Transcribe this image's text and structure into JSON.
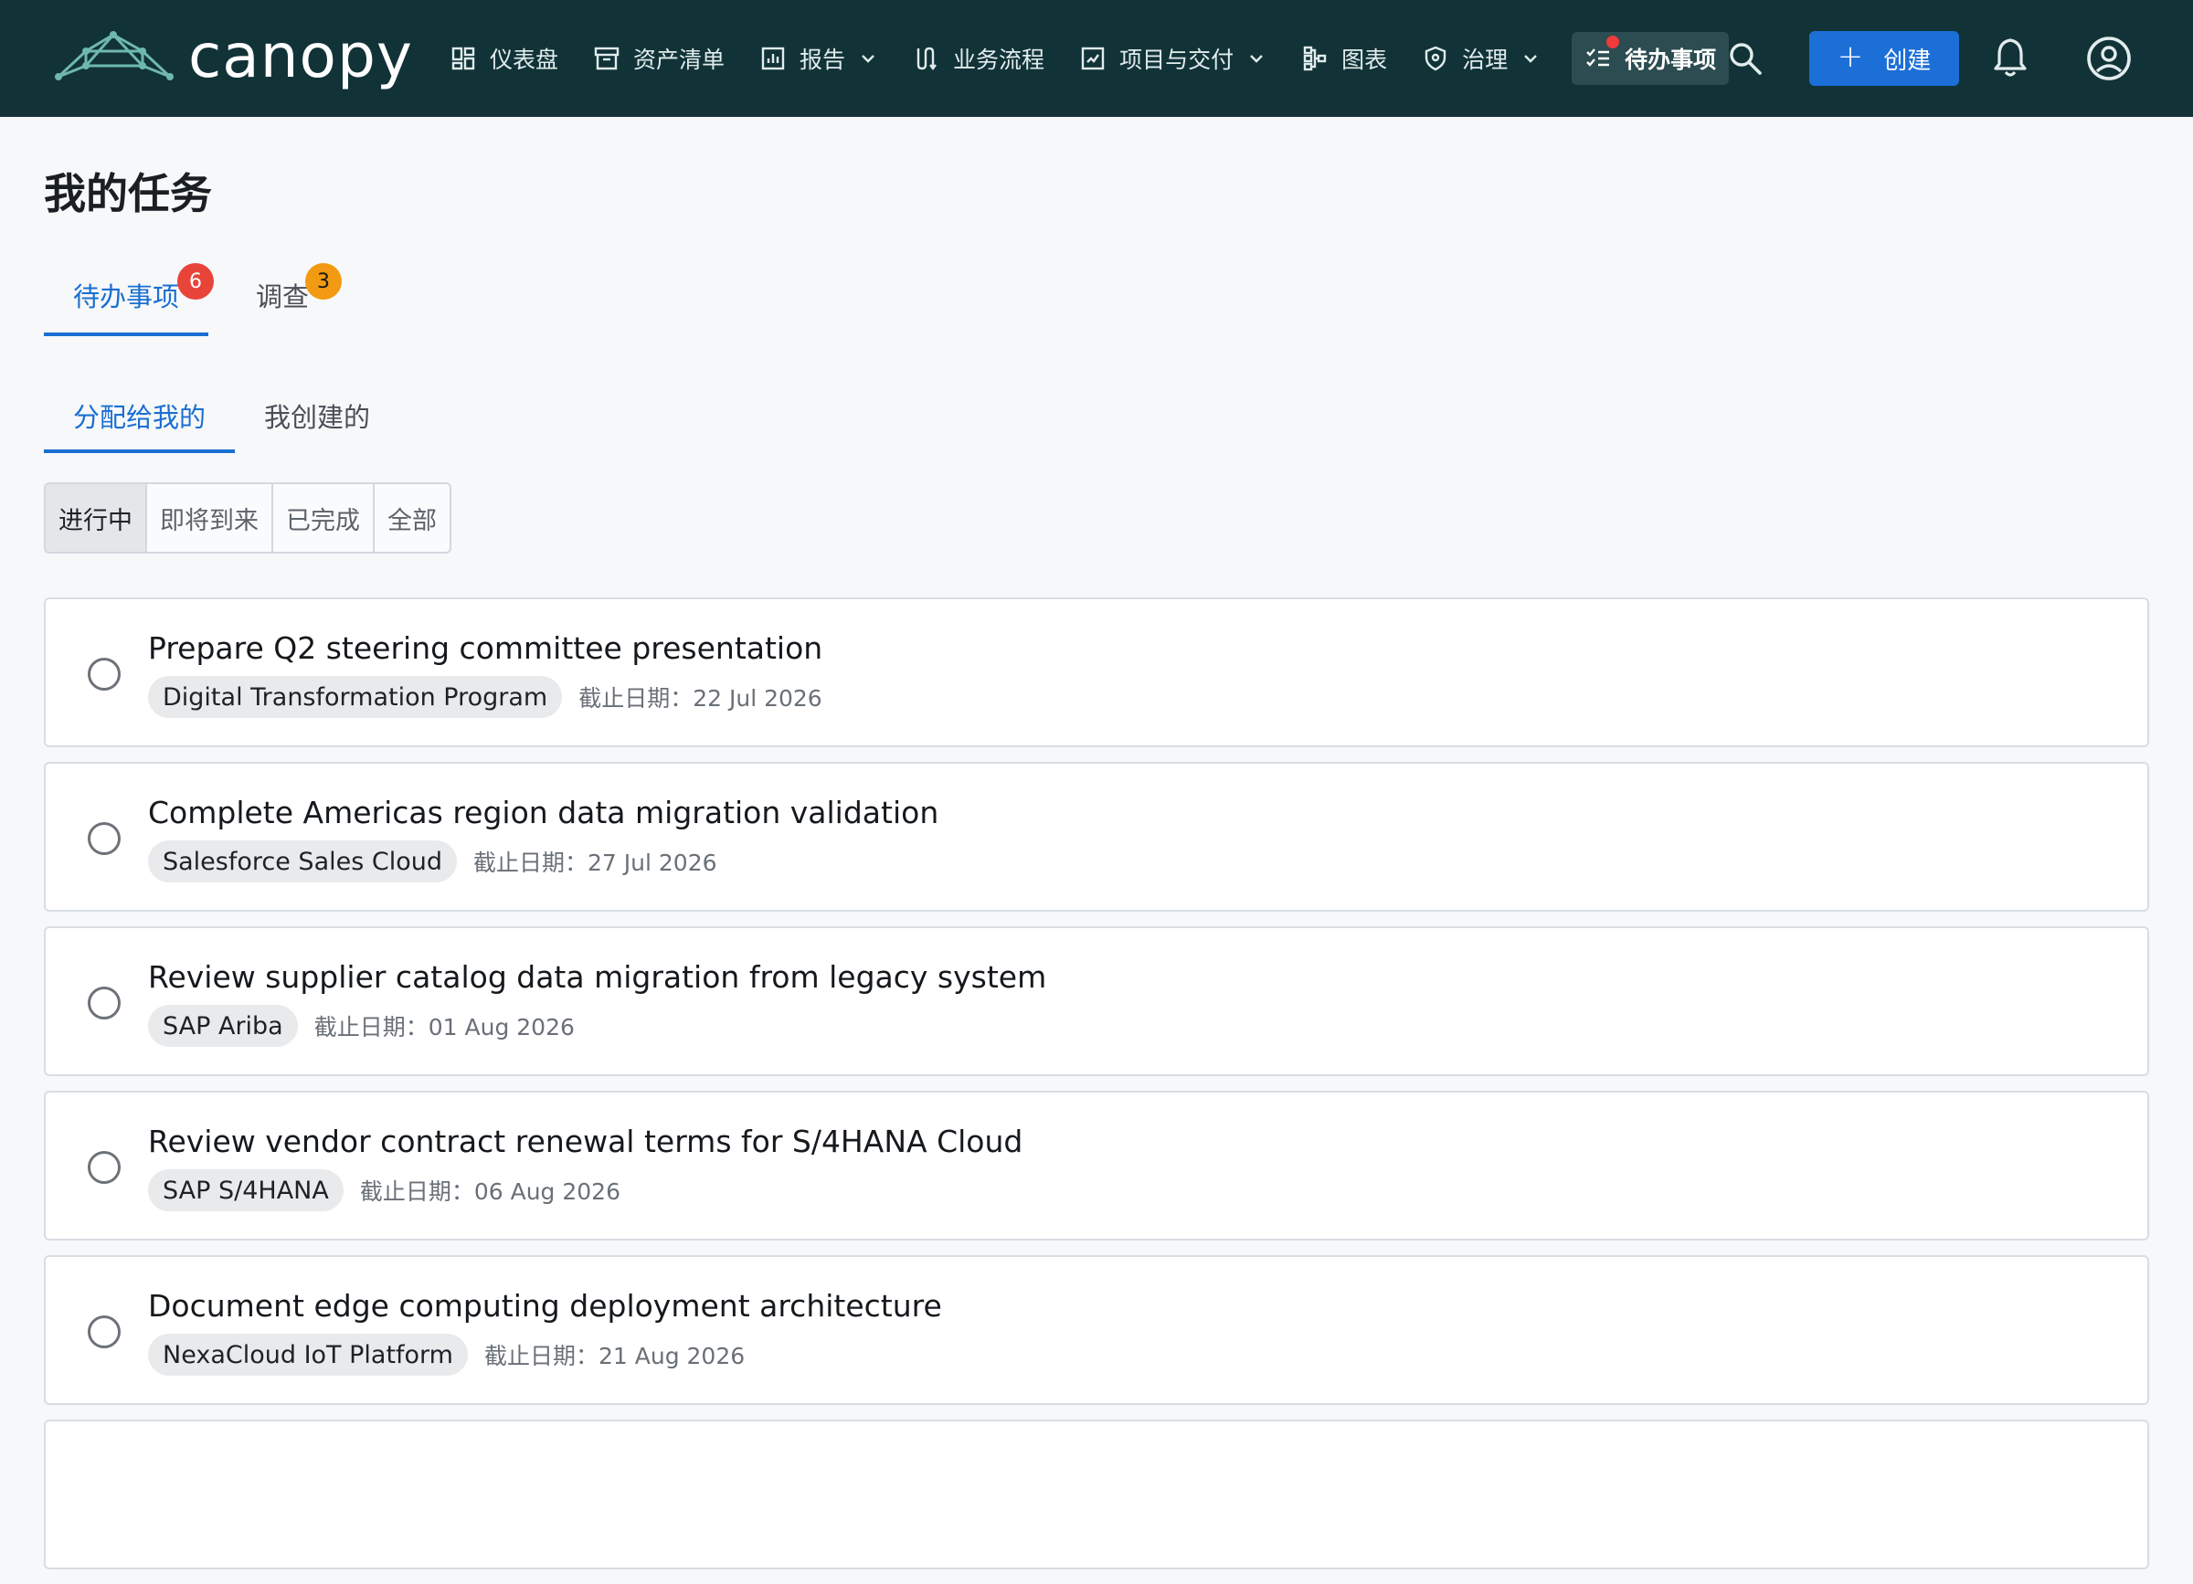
{
  "app": {
    "brand": "canopy"
  },
  "nav": {
    "items": [
      {
        "label": "仪表盘",
        "icon": "dashboard-icon",
        "has_dropdown": false
      },
      {
        "label": "资产清单",
        "icon": "archive-icon",
        "has_dropdown": false
      },
      {
        "label": "报告",
        "icon": "report-icon",
        "has_dropdown": true
      },
      {
        "label": "业务流程",
        "icon": "process-icon",
        "has_dropdown": false
      },
      {
        "label": "项目与交付",
        "icon": "project-icon",
        "has_dropdown": true
      },
      {
        "label": "图表",
        "icon": "diagram-icon",
        "has_dropdown": false
      },
      {
        "label": "治理",
        "icon": "shield-icon",
        "has_dropdown": true
      }
    ],
    "active_item": {
      "label": "待办事项",
      "icon": "checklist-icon",
      "has_notification_dot": true
    },
    "create_label": "创建",
    "search_icon": "search-icon",
    "bell_icon": "bell-icon",
    "avatar_icon": "user-avatar-icon"
  },
  "page": {
    "title": "我的任务",
    "primary_tabs": [
      {
        "label": "待办事项",
        "badge": "6",
        "active": true
      },
      {
        "label": "调查",
        "badge": "3",
        "active": false
      }
    ],
    "secondary_tabs": [
      {
        "label": "分配给我的",
        "active": true
      },
      {
        "label": "我创建的",
        "active": false
      }
    ],
    "filters": [
      {
        "label": "进行中",
        "active": true
      },
      {
        "label": "即将到来",
        "active": false
      },
      {
        "label": "已完成",
        "active": false
      },
      {
        "label": "全部",
        "active": false
      }
    ]
  },
  "tasks": [
    {
      "title": "Prepare Q2 steering committee presentation",
      "tag": "Digital Transformation Program",
      "due": "截止日期：22 Jul 2026"
    },
    {
      "title": "Complete Americas region data migration validation",
      "tag": "Salesforce Sales Cloud",
      "due": "截止日期：27 Jul 2026"
    },
    {
      "title": "Review supplier catalog data migration from legacy system",
      "tag": "SAP Ariba",
      "due": "截止日期：01 Aug 2026"
    },
    {
      "title": "Review vendor contract renewal terms for S/4HANA Cloud",
      "tag": "SAP S/4HANA",
      "due": "截止日期：06 Aug 2026"
    },
    {
      "title": "Document edge computing deployment architecture",
      "tag": "NexaCloud IoT Platform",
      "due": "截止日期：21 Aug 2026"
    }
  ],
  "colors": {
    "topbar": "#113338",
    "accent": "#1b6fd0",
    "create_button": "#1c6fd6",
    "badge_red": "#e8443a",
    "badge_orange": "#f29a11"
  }
}
